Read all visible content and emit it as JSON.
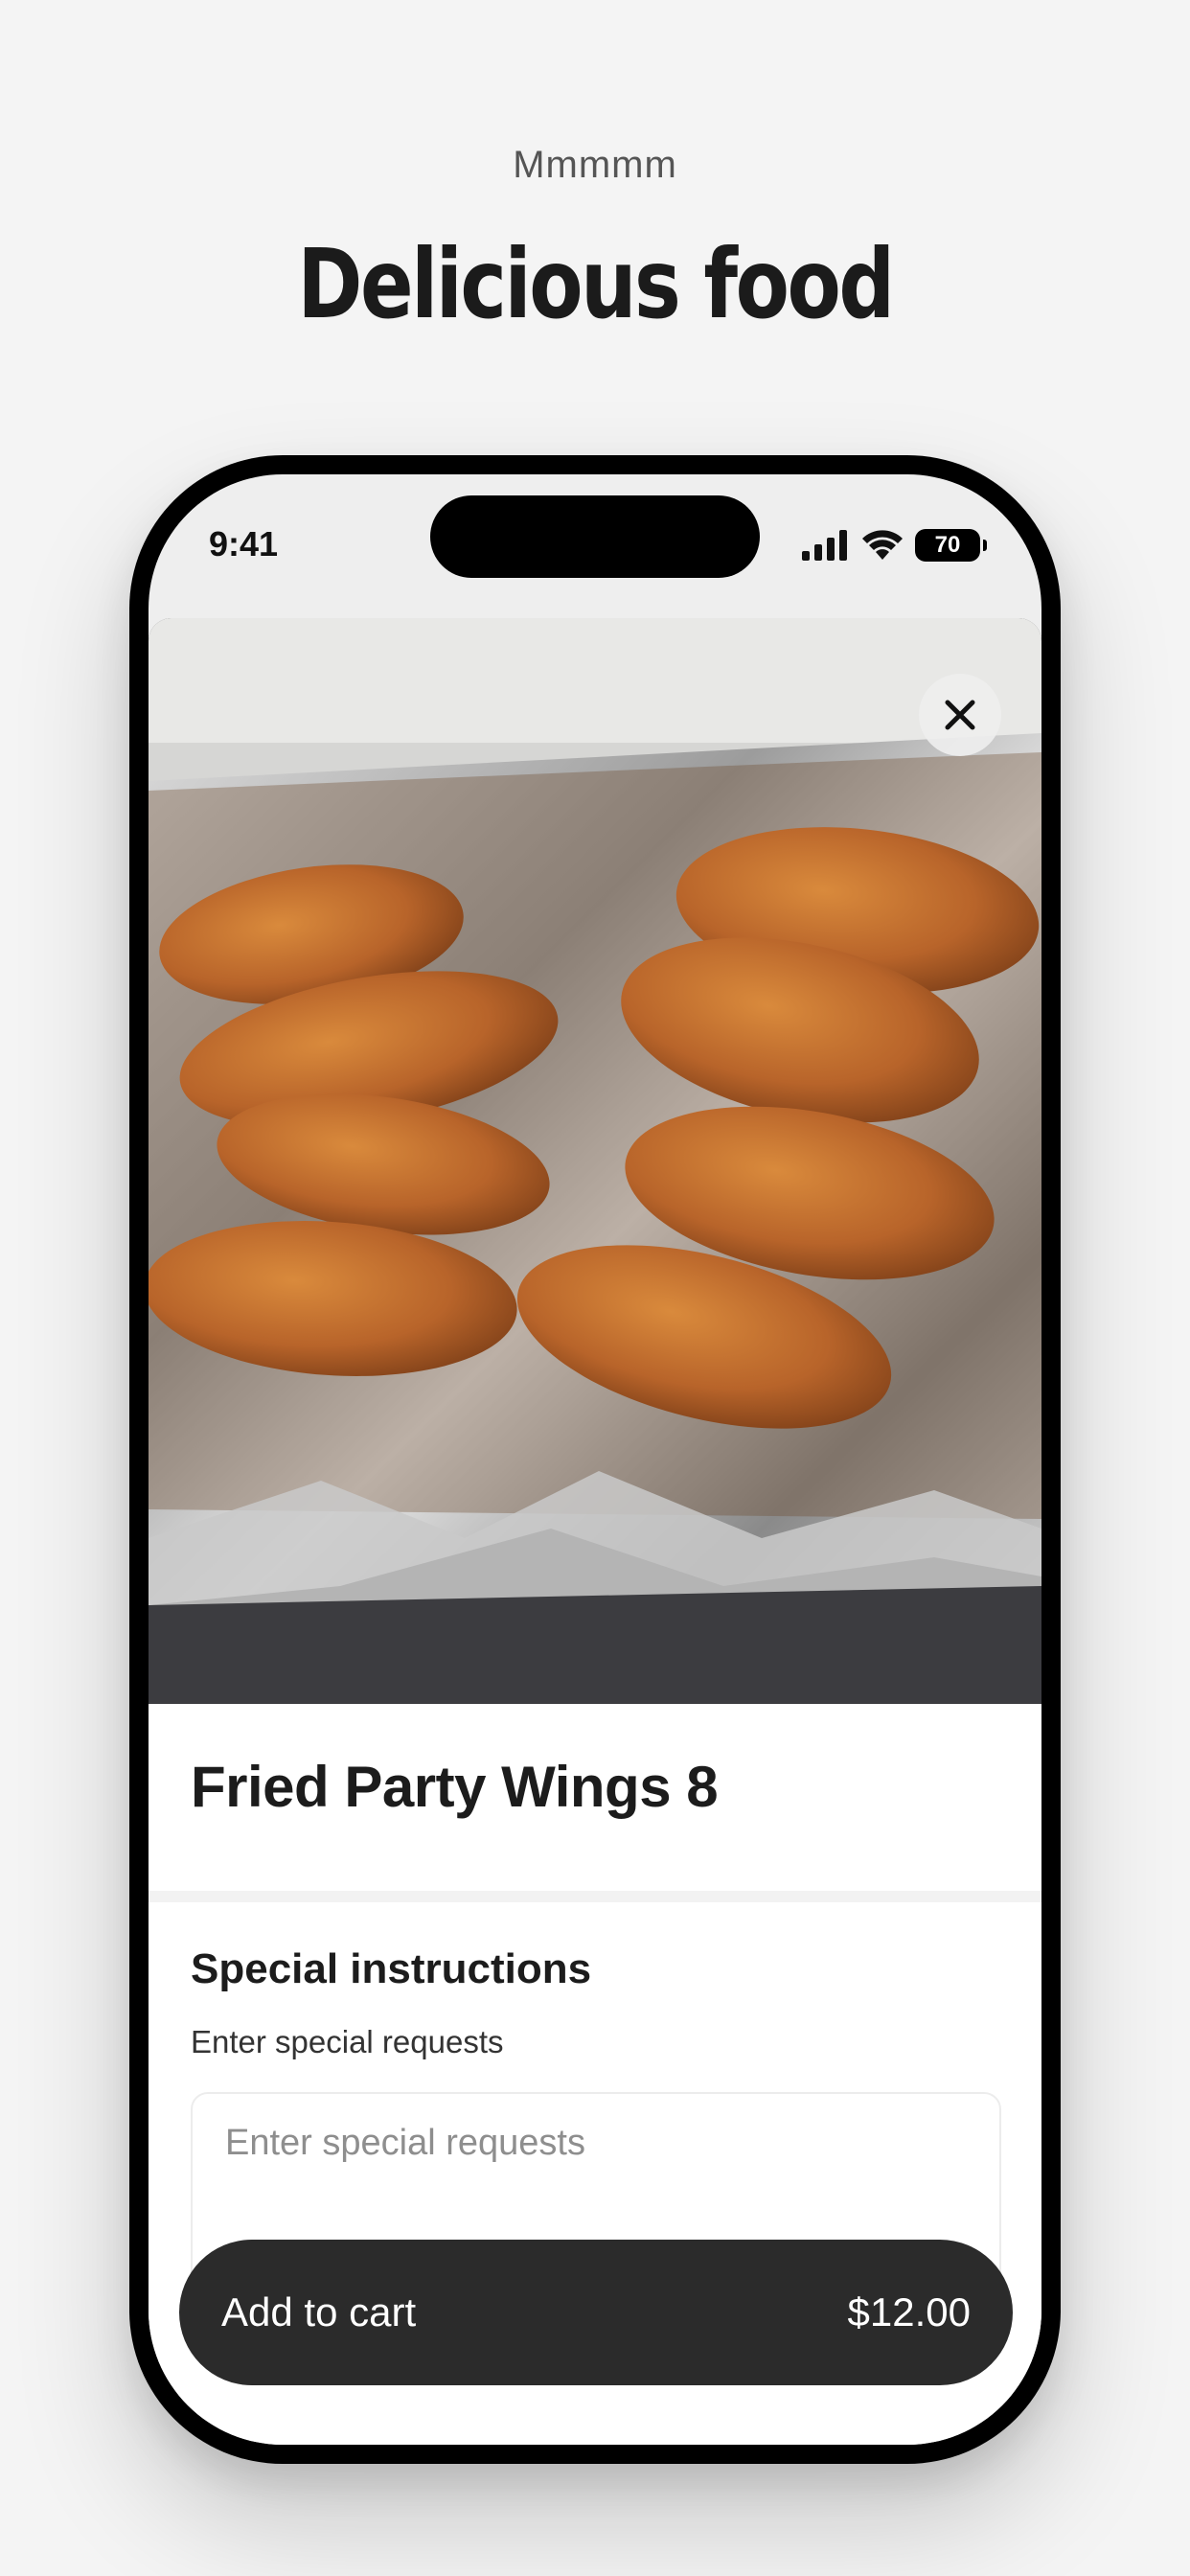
{
  "header": {
    "eyebrow": "Mmmmm",
    "title": "Delicious food"
  },
  "status_bar": {
    "time": "9:41",
    "battery": "70",
    "icons": [
      "cellular-signal-icon",
      "wifi-icon",
      "battery-icon"
    ]
  },
  "item": {
    "image_alt": "fried chicken wings on aluminum foil",
    "name": "Fried Party Wings 8",
    "close_icon": "close-icon"
  },
  "instructions": {
    "title": "Special instructions",
    "subtitle": "Enter special requests",
    "placeholder": "Enter special requests",
    "value": ""
  },
  "cart": {
    "label": "Add to cart",
    "price": "$12.00"
  },
  "colors": {
    "background": "#f4f4f4",
    "button": "#2b2b2b",
    "text": "#1c1c1c"
  }
}
